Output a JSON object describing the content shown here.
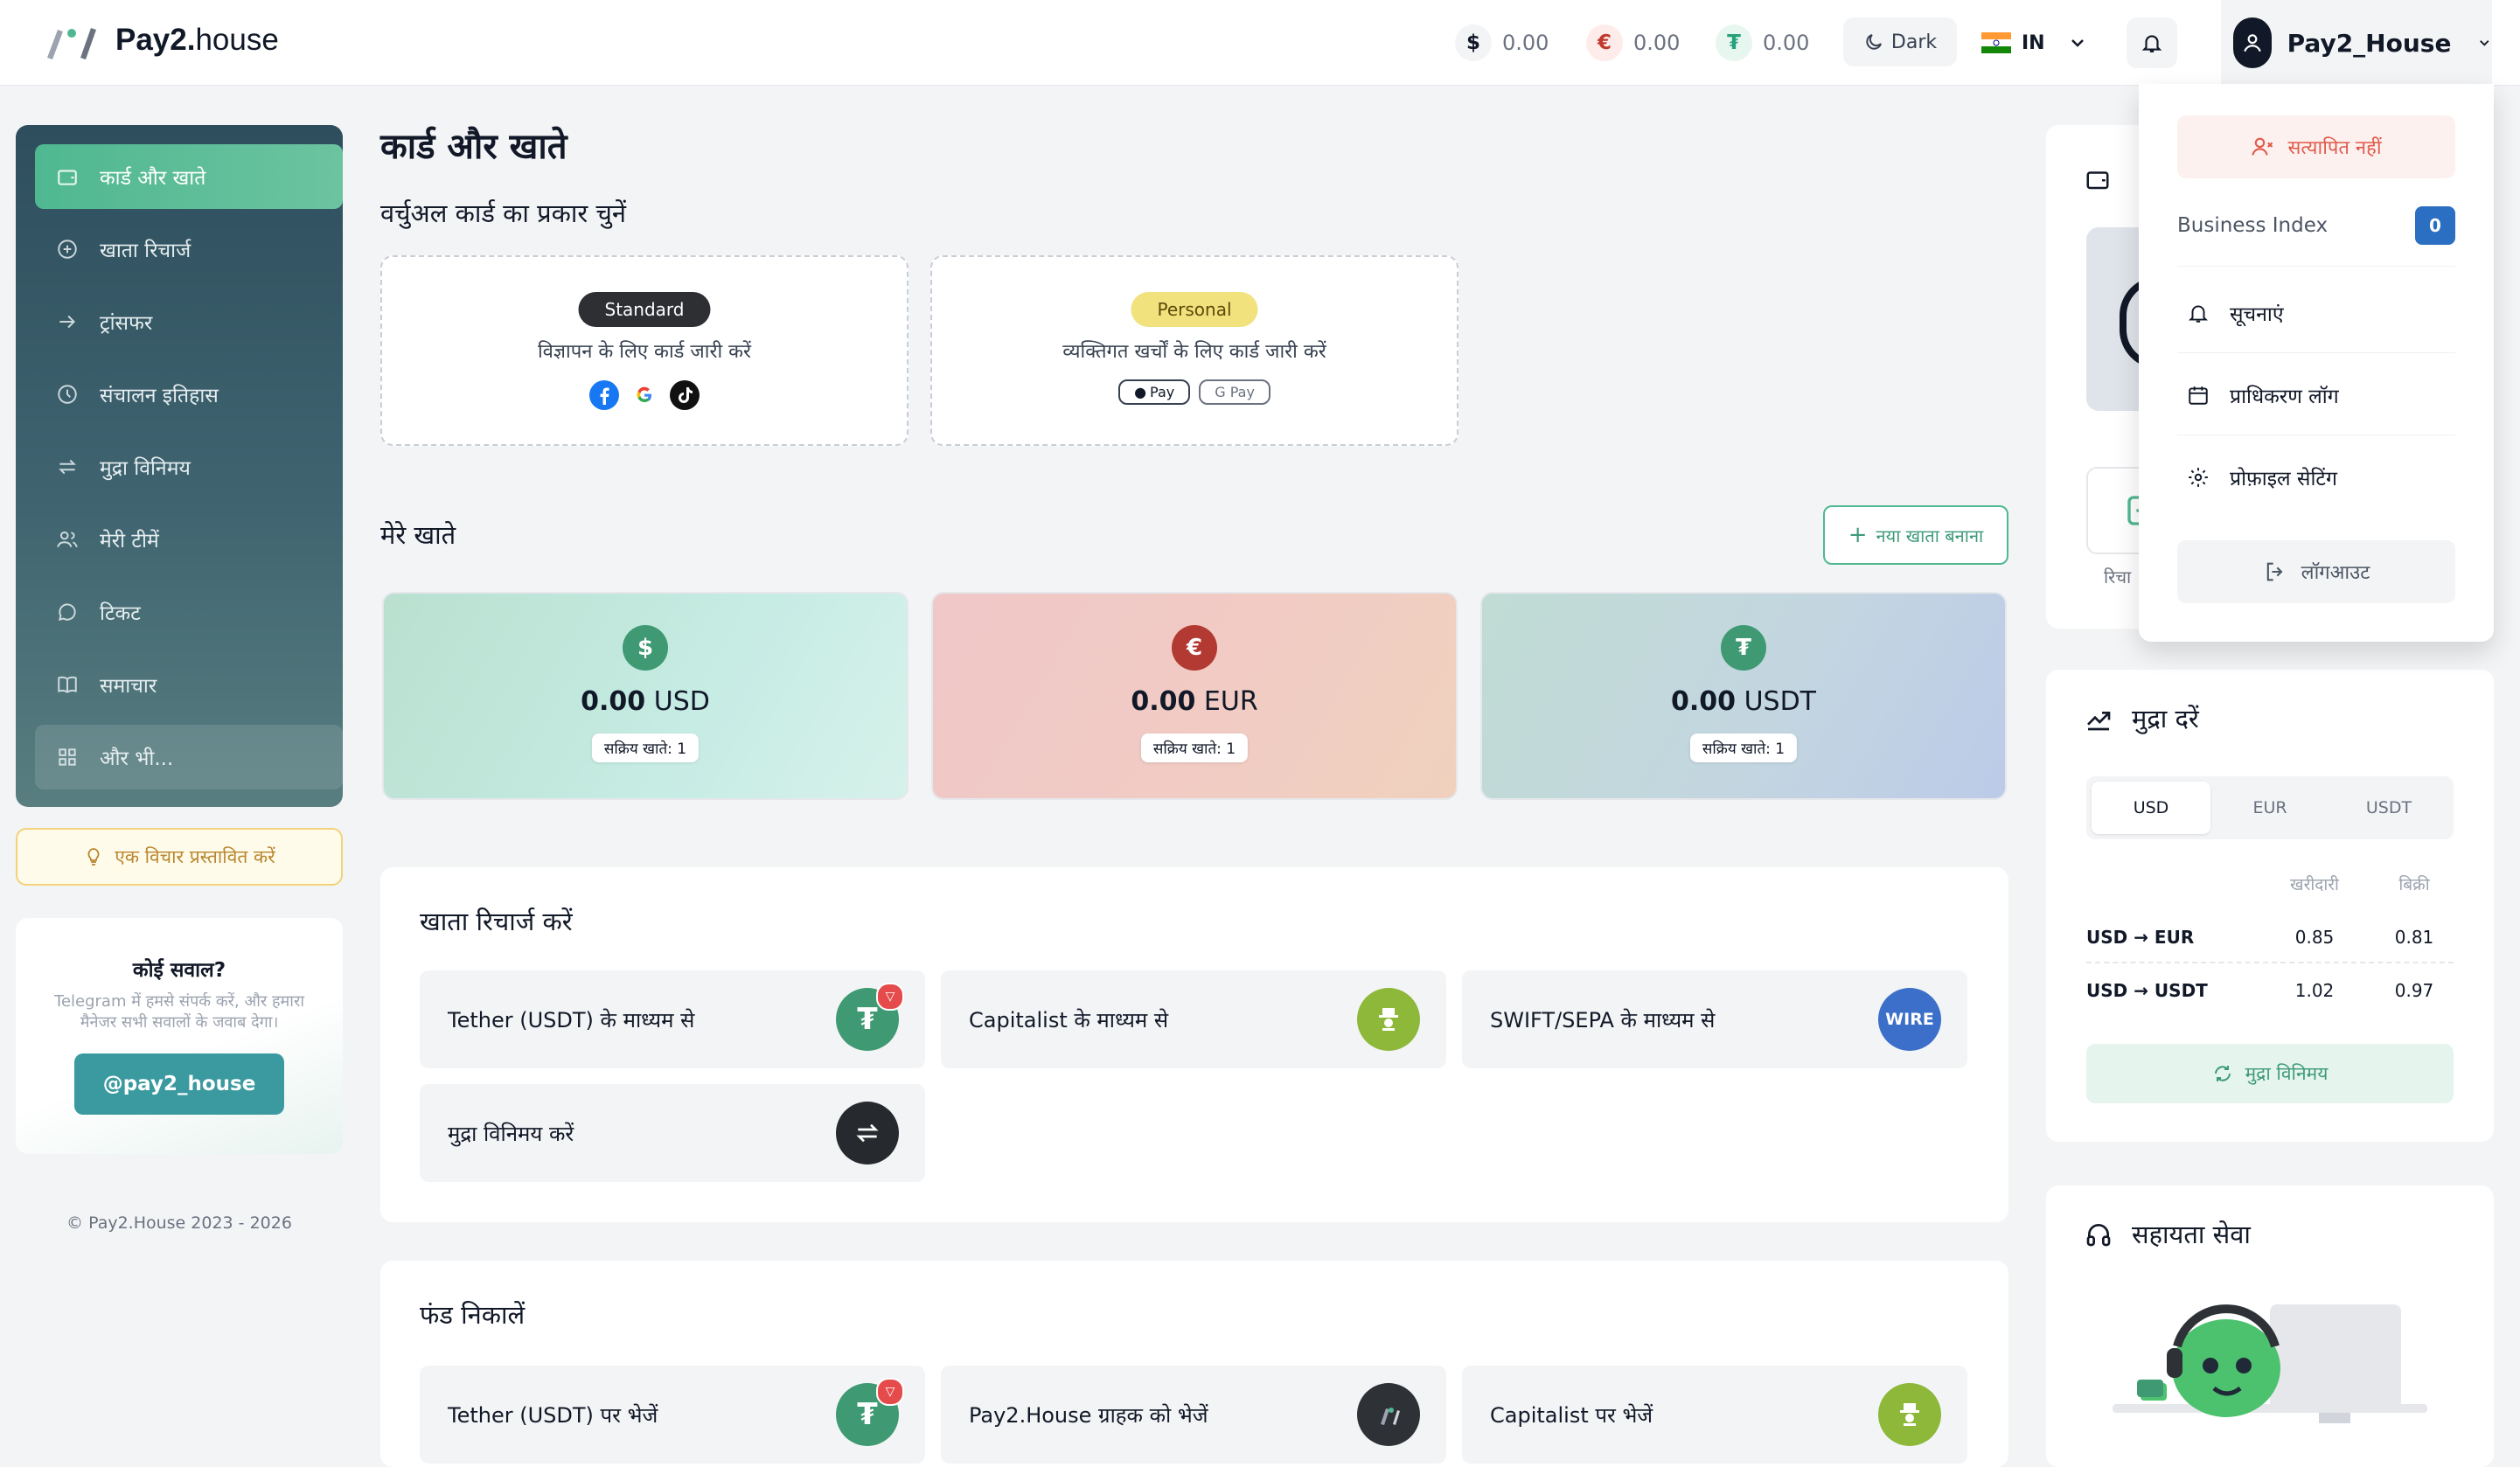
{
  "header": {
    "logo_bold": "Pay2.",
    "logo_light": "house",
    "balances": [
      {
        "symbol": "$",
        "value": "0.00",
        "color": "#111827",
        "bg": "#f3f4f6"
      },
      {
        "symbol": "€",
        "value": "0.00",
        "color": "#c0392b",
        "bg": "#fdecea"
      },
      {
        "symbol": "₮",
        "value": "0.00",
        "color": "#26a17b",
        "bg": "#e8f6f0"
      }
    ],
    "theme_label": "Dark",
    "lang_label": "IN",
    "username": "Pay2_House"
  },
  "sidebar": {
    "items": [
      {
        "label": "कार्ड और खाते",
        "icon": "wallet-icon"
      },
      {
        "label": "खाता रिचार्ज",
        "icon": "plus-circle-icon"
      },
      {
        "label": "ट्रांसफर",
        "icon": "arrow-right-icon"
      },
      {
        "label": "संचालन इतिहास",
        "icon": "clock-icon"
      },
      {
        "label": "मुद्रा विनिमय",
        "icon": "exchange-icon"
      },
      {
        "label": "मेरी टीमें",
        "icon": "users-icon"
      },
      {
        "label": "टिकट",
        "icon": "chat-icon"
      },
      {
        "label": "समाचार",
        "icon": "book-icon"
      },
      {
        "label": "और भी...",
        "icon": "grid-icon"
      }
    ],
    "idea_button": "एक विचार प्रस्तावित करें",
    "help_title": "कोई सवाल?",
    "help_text": "Telegram में हमसे संपर्क करें, और हमारा मैनेजर सभी सवालों के जवाब देगा।",
    "help_button": "@pay2_house",
    "copyright": "© Pay2.House 2023 - 2026"
  },
  "main": {
    "title": "कार्ड और खाते",
    "virtual_heading": "वर्चुअल कार्ड का प्रकार चुनें",
    "virtual_cards": [
      {
        "badge": "Standard",
        "desc": "विज्ञापन के लिए कार्ड जारी करें"
      },
      {
        "badge": "Personal",
        "desc": "व्यक्तिगत खर्चों के लिए कार्ड जारी करें",
        "pills": [
          "Pay",
          "G Pay"
        ]
      }
    ],
    "accounts_heading": "मेरे खाते",
    "new_account_button": "नया खाता बनाना",
    "accounts": [
      {
        "symbol": "$",
        "amount": "0.00",
        "currency": "USD",
        "active": "सक्रिय खाते: 1"
      },
      {
        "symbol": "€",
        "amount": "0.00",
        "currency": "EUR",
        "active": "सक्रिय खाते: 1"
      },
      {
        "symbol": "₮",
        "amount": "0.00",
        "currency": "USDT",
        "active": "सक्रिय खाते: 1"
      }
    ],
    "recharge_heading": "खाता रिचार्ज करें",
    "recharge_options": [
      "Tether (USDT) के माध्यम से",
      "Capitalist के माध्यम से",
      "SWIFT/SEPA के माध्यम से",
      "मुद्रा विनिमय करें"
    ],
    "wire_label": "WIRE",
    "withdraw_heading": "फंड निकालें",
    "withdraw_options": [
      "Tether (USDT) पर भेजें",
      "Pay2.House ग्राहक को भेजें",
      "Capitalist पर भेजें"
    ]
  },
  "rates": {
    "title": "मुद्रा दरें",
    "tabs": [
      "USD",
      "EUR",
      "USDT"
    ],
    "col_buy": "खरीदारी",
    "col_sell": "बिक्री",
    "rows": [
      {
        "pair": "USD → EUR",
        "buy": "0.85",
        "sell": "0.81"
      },
      {
        "pair": "USD → USDT",
        "buy": "1.02",
        "sell": "0.97"
      }
    ],
    "exchange_button": "मुद्रा विनिमय"
  },
  "right_partial": {
    "label": "रिचा"
  },
  "support": {
    "title": "सहायता सेवा"
  },
  "dropdown": {
    "unverified": "सत्यापित नहीं",
    "business_index_label": "Business Index",
    "business_index_value": "0",
    "items": [
      "सूचनाएं",
      "प्राधिकरण लॉग",
      "प्रोफ़ाइल सेटिंग"
    ],
    "logout": "लॉगआउट"
  }
}
